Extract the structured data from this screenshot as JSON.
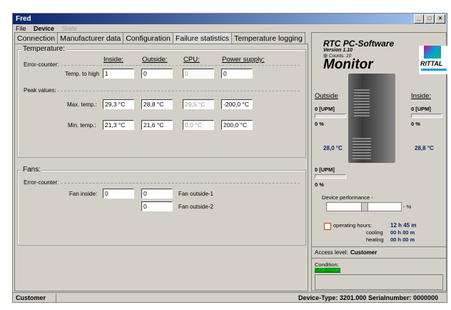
{
  "window": {
    "title": "Fred"
  },
  "menu": {
    "file": "File",
    "device": "Device",
    "state": "State"
  },
  "tabs": [
    {
      "label": "Connection"
    },
    {
      "label": "Manufacturer data"
    },
    {
      "label": "Configuration"
    },
    {
      "label": "Failure statistics"
    },
    {
      "label": "Temperature logging"
    }
  ],
  "temperature": {
    "group_label": "Temperature:",
    "error_counter_label": "Error-counter:",
    "columns": [
      "Inside:",
      "Outside:",
      "CPU:",
      "Power supply:"
    ],
    "temp_to_high_label": "Temp. to high",
    "temp_to_high": [
      "1",
      "0",
      "0",
      "0"
    ],
    "peak_values_label": "Peak values:",
    "max_label": "Max. temp.:",
    "max": [
      "29,3 °C",
      "28,8 °C",
      "29,5 °C",
      "-200,0 °C"
    ],
    "min_label": "Min. temp.:",
    "min": [
      "21,3 °C",
      "21,6 °C",
      "0,0 °C",
      "200,0 °C"
    ]
  },
  "fans": {
    "group_label": "Fans:",
    "error_counter_label": "Error-counter:",
    "fan_inside_label": "Fan inside:",
    "fan_inside_value": "0",
    "fan_outside_1_value": "0",
    "fan_outside_1_label": "Fan outside-1",
    "fan_outside_2_value": "0",
    "fan_outside_2_label": "Fan outside-2"
  },
  "monitor": {
    "product": "RTC PC-Software",
    "version": "Version 1.10",
    "counts": "Counts: 10",
    "name": "Monitor",
    "brand": "RITTAL",
    "outside_label": "Outside",
    "inside_label": "Inside:",
    "outside_upm": "0 [UPM]",
    "inside_upm": "0 [UPM]",
    "outside_pct": "0 %",
    "inside_pct": "0 %",
    "outside_temp": "28,0 °C",
    "inside_temp": "28,8 °C",
    "lower_upm": "0 [UPM]",
    "lower_pct": "0 %",
    "device_performance_label": "Device performance",
    "device_performance_dash": "-",
    "device_performance_unit": "- %",
    "operating_hours_label": "operating hours:",
    "operating_hours_value": "12 h 45 m",
    "cooling_label": "cooling",
    "cooling_value": "00 h 00 m",
    "heating_label": "heating",
    "heating_value": "00 h 00 m",
    "access_level_label": "Access level:",
    "access_level_value": "Customer",
    "condition_label": "Condition:",
    "condition_value": "USB-mode"
  },
  "status": {
    "user": "Customer",
    "device_info": "Device-Type: 3201.000  Serialnumber: 0000000"
  },
  "colors": {
    "titlebar": "#0a246a",
    "accent_navy": "#0a246a",
    "condition_green": "#008000"
  }
}
